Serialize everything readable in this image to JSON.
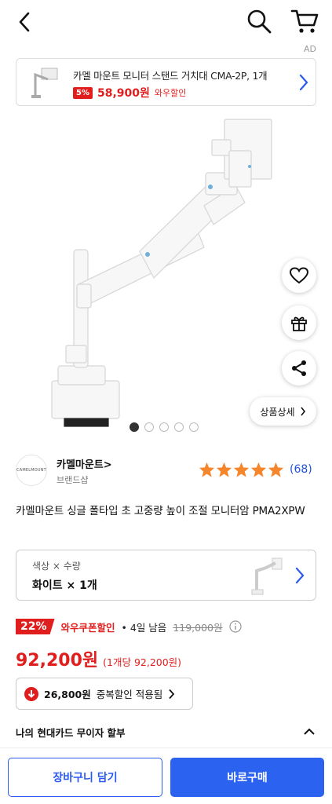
{
  "header": {
    "back_icon": "chevron-left-icon",
    "search_icon": "search-icon",
    "cart_icon": "cart-icon",
    "ad_label": "AD"
  },
  "ad_banner": {
    "title": "카멜 마운트 모니터 스탠드 거치대 CMA-2P, 1개",
    "discount_pct": "5%",
    "price": "58,900원",
    "discount_label": "와우할인"
  },
  "hero": {
    "image": "monitor-arm-product-image",
    "dots_total": 5,
    "dots_active_index": 0,
    "detail_button": "상품상세"
  },
  "brand": {
    "logo_text": "CAMELMOUNT",
    "name": "카멜마운트>",
    "shop_label": "브랜드샵",
    "rating": 5,
    "review_count": "(68)"
  },
  "product": {
    "name": "카멜마운트 싱글 폴타입 초 고중량 높이 조절 모니터암 PMA2XPW"
  },
  "option": {
    "label": "색상 × 수량",
    "value": "화이트 × 1개"
  },
  "pricing": {
    "discount_pct": "22%",
    "coupon_name": "와우쿠폰할인",
    "remaining": "• 4일 남음",
    "original_price": "119,000원",
    "final_price": "92,200원",
    "unit_price": "(1개당 92,200원)"
  },
  "duplicate_discount": {
    "amount": "26,800원",
    "text": "중복할인 적용됨"
  },
  "card_installment": {
    "text": "나의 현대카드 무이자 할부"
  },
  "bottom_bar": {
    "add_to_cart": "장바구니 담기",
    "buy_now": "바로구매"
  },
  "colors": {
    "accent_red": "#e01e1e",
    "accent_blue": "#2b63f0",
    "star_orange": "#f6862c"
  }
}
